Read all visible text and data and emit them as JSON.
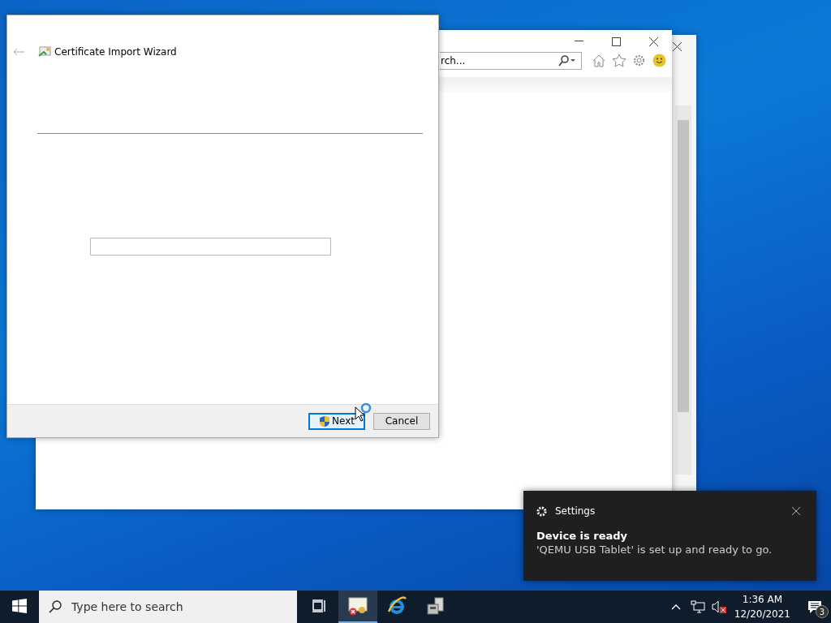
{
  "browser_window": {
    "search": {
      "value": "rch..."
    }
  },
  "wizard": {
    "title": "Certificate Import Wizard",
    "field": {
      "kind": "text"
    },
    "buttons": [
      {
        "label": "Next",
        "kind": "shield",
        "selected": true
      },
      {
        "label": "Cancel",
        "kind": "plain",
        "selected": false
      }
    ]
  },
  "notification": {
    "app": "Settings",
    "title": "Device is ready",
    "message": "'QEMU USB Tablet' is set up and ready to go."
  },
  "taskbar": {
    "search": {
      "placeholder": "Type here to search"
    },
    "apps": [
      {
        "kind": "certificate",
        "selected": true
      },
      {
        "kind": "browser",
        "selected": false
      },
      {
        "kind": "setup",
        "selected": false
      }
    ],
    "time": "1:36 AM",
    "date": "12/20/2021",
    "notification_count": "3"
  }
}
